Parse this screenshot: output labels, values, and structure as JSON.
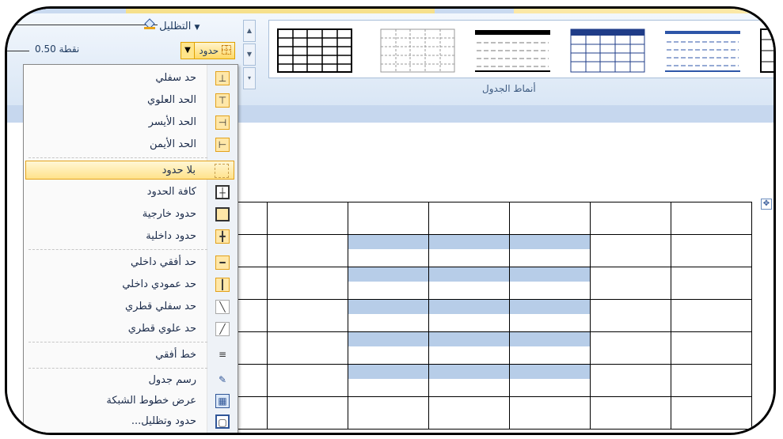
{
  "ribbon": {
    "shading_label": "التظليل",
    "borders_label": "حدود",
    "pen_weight": "0.50 نقطة",
    "styles_group_label": "أنماط الجدول"
  },
  "table_styles": [
    {
      "name": "style-1",
      "header_color": "#000000"
    },
    {
      "name": "style-2",
      "header_color": "#808080"
    },
    {
      "name": "style-3",
      "header_color": "#000000"
    },
    {
      "name": "style-4",
      "header_color": "#1f3c88"
    },
    {
      "name": "style-5",
      "header_color": "#2e56a8"
    },
    {
      "name": "style-6",
      "header_color": "#000000"
    }
  ],
  "borders_menu": {
    "items": [
      {
        "label": "حد سفلي",
        "icon": "bottom-border-icon",
        "checked": true
      },
      {
        "label": "الحد العلوي",
        "icon": "top-border-icon",
        "checked": true
      },
      {
        "label": "الحد الأيسر",
        "icon": "left-border-icon",
        "checked": true
      },
      {
        "label": "الحد الأيمن",
        "icon": "right-border-icon",
        "checked": true
      },
      {
        "label": "بلا حدود",
        "icon": "no-border-icon",
        "checked": false,
        "hovered": true
      },
      {
        "label": "كافة الحدود",
        "icon": "all-borders-icon",
        "checked": false
      },
      {
        "label": "حدود خارجية",
        "icon": "outside-borders-icon",
        "checked": true
      },
      {
        "label": "حدود داخلية",
        "icon": "inside-borders-icon",
        "checked": true
      },
      {
        "label": "حد أفقي داخلي",
        "icon": "inside-horizontal-border-icon",
        "checked": true
      },
      {
        "label": "حد عمودي داخلي",
        "icon": "inside-vertical-border-icon",
        "checked": true
      },
      {
        "label": "حد سفلي قطري",
        "icon": "diagonal-down-border-icon",
        "checked": false
      },
      {
        "label": "حد علوي قطري",
        "icon": "diagonal-up-border-icon",
        "checked": false
      },
      {
        "label": "خط أفقي",
        "icon": "horizontal-line-icon",
        "checked": false
      },
      {
        "label": "رسم جدول",
        "icon": "draw-table-icon",
        "checked": false
      },
      {
        "label": "عرض خطوط الشبكة",
        "icon": "view-gridlines-icon",
        "checked": false
      },
      {
        "label": "حدود وتظليل...",
        "icon": "borders-shading-dialog-icon",
        "checked": false
      }
    ]
  },
  "colors": {
    "highlight": "#ffe28a",
    "cell_shade": "#b7cde8",
    "ribbon_bg": "#d9e6f5"
  }
}
